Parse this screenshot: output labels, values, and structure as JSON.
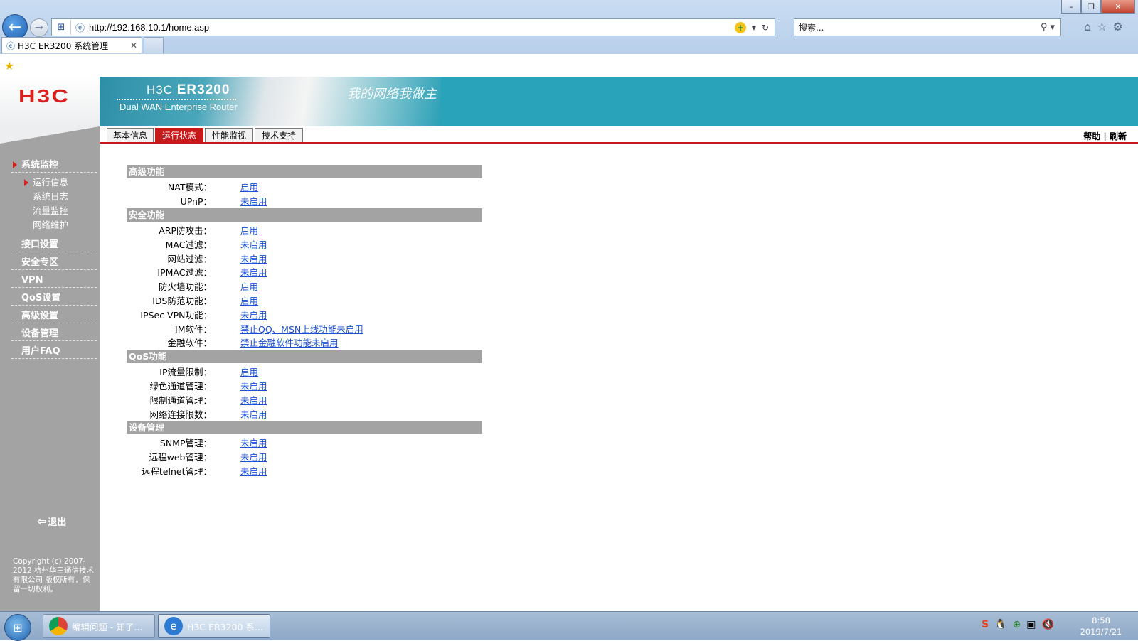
{
  "browser": {
    "window_controls": [
      "–",
      "❐",
      "✕"
    ],
    "url": "http://192.168.10.1/home.asp",
    "search_placeholder": "搜索...",
    "tabs": [
      {
        "title": "H3C ER3200 系统管理",
        "close": "✕"
      }
    ]
  },
  "header": {
    "logo": "H3C",
    "product_prefix": "H3C",
    "product_model": "ER3200",
    "subtitle": "Dual WAN Enterprise Router",
    "slogan": "我的网络我做主"
  },
  "page_tabs": [
    {
      "label": "基本信息",
      "active": false
    },
    {
      "label": "运行状态",
      "active": true
    },
    {
      "label": "性能监视",
      "active": false
    },
    {
      "label": "技术支持",
      "active": false
    }
  ],
  "help_links": {
    "help": "帮助",
    "sep": "|",
    "refresh": "刷新"
  },
  "sidebar": {
    "items": [
      {
        "label": "系统监控",
        "active": true
      },
      {
        "label": "接口设置"
      },
      {
        "label": "安全专区"
      },
      {
        "label": "VPN"
      },
      {
        "label": "QoS设置"
      },
      {
        "label": "高级设置"
      },
      {
        "label": "设备管理"
      },
      {
        "label": "用户FAQ"
      }
    ],
    "sub_items": [
      {
        "label": "运行信息",
        "active": true
      },
      {
        "label": "系统日志"
      },
      {
        "label": "流量监控"
      },
      {
        "label": "网络维护"
      }
    ],
    "logout": "退出",
    "copyright": "Copyright (c) 2007-2012  杭州华三通信技术有限公司 版权所有，保留一切权利。"
  },
  "sections": [
    {
      "title": "高级功能",
      "rows": [
        {
          "label": "NAT模式：",
          "value": "启用"
        },
        {
          "label": "UPnP：",
          "value": "未启用"
        }
      ]
    },
    {
      "title": "安全功能",
      "rows": [
        {
          "label": "ARP防攻击：",
          "value": "启用"
        },
        {
          "label": "MAC过滤：",
          "value": "未启用"
        },
        {
          "label": "网站过滤：",
          "value": "未启用"
        },
        {
          "label": "IPMAC过滤：",
          "value": "未启用"
        },
        {
          "label": "防火墙功能：",
          "value": "启用"
        },
        {
          "label": "IDS防范功能：",
          "value": "启用"
        },
        {
          "label": "IPSec VPN功能：",
          "value": "未启用"
        },
        {
          "label": "IM软件：",
          "value": "禁止QQ、MSN上线功能未启用"
        },
        {
          "label": "金融软件：",
          "value": "禁止金融软件功能未启用"
        }
      ]
    },
    {
      "title": "QoS功能",
      "rows": [
        {
          "label": "IP流量限制：",
          "value": "启用"
        },
        {
          "label": "绿色通道管理：",
          "value": "未启用"
        },
        {
          "label": "限制通道管理：",
          "value": "未启用"
        },
        {
          "label": "网络连接限数：",
          "value": "未启用"
        }
      ]
    },
    {
      "title": "设备管理",
      "rows": [
        {
          "label": "SNMP管理：",
          "value": "未启用"
        },
        {
          "label": "远程web管理：",
          "value": "未启用"
        },
        {
          "label": "远程telnet管理：",
          "value": "未启用"
        }
      ]
    }
  ],
  "taskbar": {
    "buttons": [
      {
        "label": "编辑问题 - 知了...",
        "icon": "chrome-icon",
        "active": false
      },
      {
        "label": "H3C ER3200 系...",
        "icon": "ie-icon",
        "active": true
      }
    ],
    "time": "8:58",
    "date": "2019/7/21"
  },
  "colors": {
    "accent_red": "#c8191a",
    "banner_teal": "#29a3b9",
    "sidebar_gray": "#a3a3a3",
    "link_blue": "#1a4fcf"
  }
}
